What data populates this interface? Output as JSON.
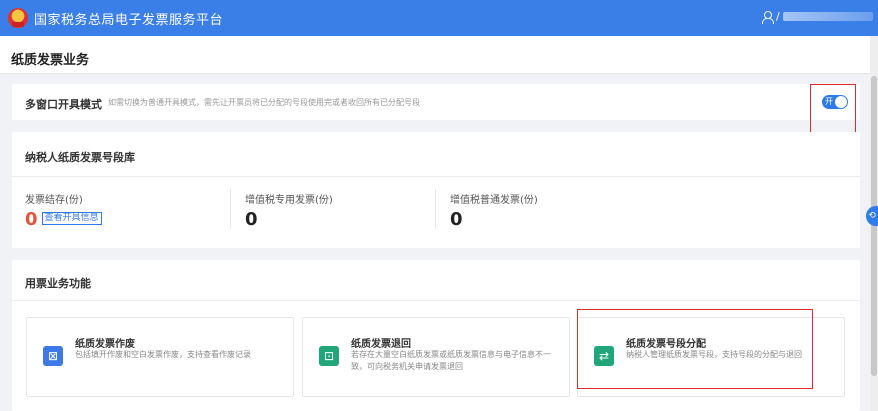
{
  "app": {
    "title": "国家税务总局电子发票服务平台",
    "user_prefix": "/"
  },
  "page": {
    "title": "纸质发票业务"
  },
  "multi_window": {
    "title": "多窗口开具模式",
    "description": "如需切换为普通开具模式，需先让开票员将已分配的号段使用完或者收回所有已分配号段",
    "toggle_label": "开",
    "toggle_on": true
  },
  "pool": {
    "title": "纳税人纸质发票号段库",
    "stats": [
      {
        "label": "发票结存(份)",
        "value": "0",
        "link": "查看开具信息"
      },
      {
        "label": "增值税专用发票(份)",
        "value": "0"
      },
      {
        "label": "增值税普通发票(份)",
        "value": "0"
      }
    ]
  },
  "functions": {
    "title": "用票业务功能",
    "items": [
      {
        "title": "纸质发票作废",
        "desc": "包括填开作废和空白发票作废，支持查看作废记录",
        "icon": "void-icon"
      },
      {
        "title": "纸质发票退回",
        "desc": "若存在大量空白纸质发票或纸质发票信息与电子信息不一致，可向税务机关申请发票退回",
        "icon": "return-icon"
      },
      {
        "title": "纸质发票号段分配",
        "desc": "纳税人管理纸质发票号段，支持号段的分配与退回",
        "icon": "swap-icon"
      }
    ]
  },
  "colors": {
    "header": "#3a7ee8",
    "accent": "#2f7bea",
    "highlight": "#e02b2b",
    "zero_red": "#e2553a"
  }
}
